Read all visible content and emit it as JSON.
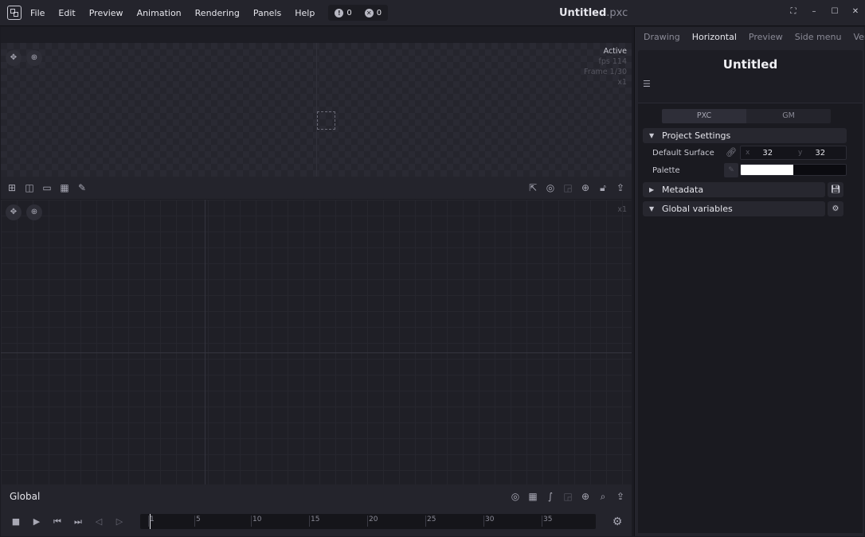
{
  "menu": [
    "File",
    "Edit",
    "Preview",
    "Animation",
    "Rendering",
    "Panels",
    "Help"
  ],
  "notifications": {
    "warnings": "0",
    "errors": "0"
  },
  "window": {
    "title": "Untitled",
    "extension": ".pxc"
  },
  "preview": {
    "status": "Active",
    "fps": "fps 114",
    "frame": "Frame 1/30",
    "zoom": "x1"
  },
  "graph": {
    "zoom": "x1",
    "context_label": "Global"
  },
  "timeline": {
    "ticks": [
      "1",
      "5",
      "10",
      "15",
      "20",
      "25",
      "30",
      "35"
    ]
  },
  "right_panel": {
    "tabs": [
      "Drawing",
      "Horizontal",
      "Preview",
      "Side menu",
      "Vertic"
    ],
    "active_tab": "Horizontal",
    "project_title": "Untitled",
    "segments": [
      "PXC",
      "GM"
    ],
    "sections": {
      "project_settings": "Project Settings",
      "metadata": "Metadata",
      "global_variables": "Global variables"
    },
    "default_surface": {
      "label": "Default Surface",
      "x_label": "x",
      "x": "32",
      "y_label": "y",
      "y": "32"
    },
    "palette": {
      "label": "Palette",
      "colors": [
        "#ffffff",
        "#0b0b10"
      ]
    }
  },
  "colors": {
    "background": "#1b1b22",
    "panel": "#24242c",
    "text": "#e6e6ec"
  }
}
